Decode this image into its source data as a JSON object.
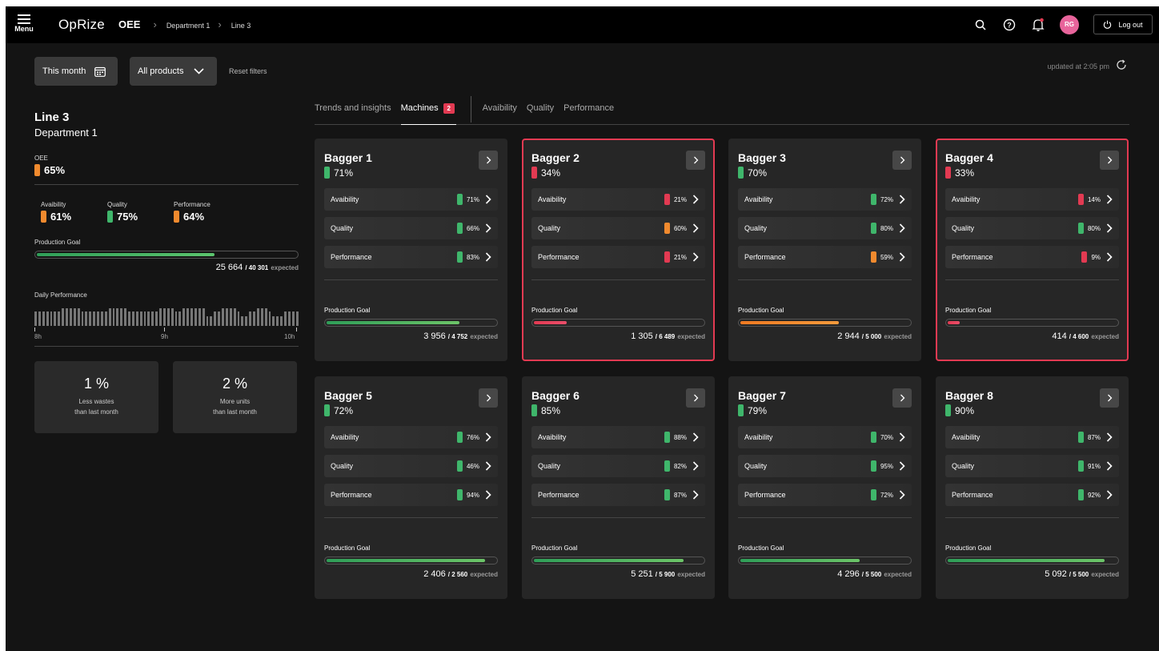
{
  "app": {
    "menu_label": "Menu",
    "logo": "OpRize"
  },
  "breadcrumb": {
    "root": "OEE",
    "dept": "Department 1",
    "line": "Line 3"
  },
  "user": {
    "initials": "RG",
    "logout_label": "Log out"
  },
  "filters": {
    "period": "This month",
    "products": "All products",
    "reset": "Reset filters",
    "updated": "updated at 2:05 pm"
  },
  "colors": {
    "green": "#3fb66b",
    "orange": "#f08a2e",
    "red": "#e23a52",
    "avatar": "#e8649b"
  },
  "line": {
    "title": "Line 3",
    "department": "Department 1",
    "oee_label": "OEE",
    "oee": "65%",
    "oee_color": "orange",
    "metrics": [
      {
        "label": "Avaibility",
        "value": "61%",
        "color": "orange"
      },
      {
        "label": "Quality",
        "value": "75%",
        "color": "green"
      },
      {
        "label": "Performance",
        "value": "64%",
        "color": "orange"
      }
    ],
    "goal_label": "Production Goal",
    "goal_fraction": 0.69,
    "goal_actual": "25 664",
    "goal_expected": "/ 40 301",
    "goal_suffix": "expected",
    "daily_label": "Daily Performance",
    "daily_levels": [
      0.75,
      0.75,
      0.75,
      0.75,
      0.75,
      0.75,
      0.75,
      0.9,
      0.9,
      0.9,
      0.9,
      0.9,
      0.75,
      0.75,
      0.75,
      0.75,
      0.75,
      0.75,
      0.75,
      0.9,
      0.9,
      0.9,
      0.9,
      0.9,
      0.75,
      0.75,
      0.75,
      0.75,
      0.75,
      0.75,
      0.75,
      0.75,
      0.9,
      0.9,
      0.9,
      0.9,
      0.75,
      0.75,
      0.9,
      0.9,
      0.9,
      0.9,
      0.9,
      0.9,
      0.5,
      0.5,
      0.75,
      0.75,
      0.9,
      0.9,
      0.9,
      0.9,
      0.75,
      0.5,
      0.5,
      0.75,
      0.75,
      0.9,
      0.9,
      0.9,
      0.75,
      0.5,
      0.5,
      0.5,
      0.75,
      0.75,
      0.75,
      0.75
    ],
    "axis": [
      "8h",
      "9h",
      "10h"
    ],
    "stats": [
      {
        "value": "1 %",
        "line1": "Less wastes",
        "line2": "than last month"
      },
      {
        "value": "2 %",
        "line1": "More units",
        "line2": "than last month"
      }
    ]
  },
  "tabs": {
    "trends": "Trends and insights",
    "machines": "Machines",
    "machines_badge": "2",
    "availability": "Avaibility",
    "quality": "Quality",
    "performance": "Performance"
  },
  "machine_labels": {
    "availability": "Avaibility",
    "quality": "Quality",
    "performance": "Performance",
    "goal": "Production Goal",
    "expected": "expected"
  },
  "machines": [
    {
      "name": "Bagger 1",
      "oee": "71%",
      "oee_color": "green",
      "alert": false,
      "availability": "71%",
      "availability_color": "green",
      "quality": "66%",
      "quality_color": "green",
      "performance": "83%",
      "performance_color": "green",
      "goal_fraction": 0.79,
      "goal_color": "green",
      "actual": "3 956",
      "expected": "/ 4 752"
    },
    {
      "name": "Bagger 2",
      "oee": "34%",
      "oee_color": "red",
      "alert": true,
      "availability": "21%",
      "availability_color": "red",
      "quality": "60%",
      "quality_color": "orange",
      "performance": "21%",
      "performance_color": "red",
      "goal_fraction": 0.21,
      "goal_color": "red",
      "actual": "1 305",
      "expected": " / 6 489"
    },
    {
      "name": "Bagger 3",
      "oee": "70%",
      "oee_color": "green",
      "alert": false,
      "availability": "72%",
      "availability_color": "green",
      "quality": "80%",
      "quality_color": "green",
      "performance": "59%",
      "performance_color": "orange",
      "goal_fraction": 0.59,
      "goal_color": "orange",
      "actual": "2 944",
      "expected": "/ 5 000"
    },
    {
      "name": "Bagger 4",
      "oee": "33%",
      "oee_color": "red",
      "alert": true,
      "availability": "14%",
      "availability_color": "red",
      "quality": "80%",
      "quality_color": "green",
      "performance": "9%",
      "performance_color": "red",
      "goal_fraction": 0.09,
      "goal_color": "red",
      "actual": "414",
      "expected": "/ 4 600"
    },
    {
      "name": "Bagger 5",
      "oee": "72%",
      "oee_color": "green",
      "alert": false,
      "availability": "76%",
      "availability_color": "green",
      "quality": "46%",
      "quality_color": "green",
      "performance": "94%",
      "performance_color": "green",
      "goal_fraction": 0.94,
      "goal_color": "green",
      "actual": "2 406",
      "expected": "/ 2 560"
    },
    {
      "name": "Bagger 6",
      "oee": "85%",
      "oee_color": "green",
      "alert": false,
      "availability": "88%",
      "availability_color": "green",
      "quality": "82%",
      "quality_color": "green",
      "performance": "87%",
      "performance_color": "green",
      "goal_fraction": 0.89,
      "goal_color": "green",
      "actual": "5 251",
      "expected": "/ 5 900"
    },
    {
      "name": "Bagger 7",
      "oee": "79%",
      "oee_color": "green",
      "alert": false,
      "availability": "70%",
      "availability_color": "green",
      "quality": "95%",
      "quality_color": "green",
      "performance": "72%",
      "performance_color": "green",
      "goal_fraction": 0.71,
      "goal_color": "green",
      "actual": "4 296",
      "expected": "/ 5 500"
    },
    {
      "name": "Bagger 8",
      "oee": "90%",
      "oee_color": "green",
      "alert": false,
      "availability": "87%",
      "availability_color": "green",
      "quality": "91%",
      "quality_color": "green",
      "performance": "92%",
      "performance_color": "green",
      "goal_fraction": 0.93,
      "goal_color": "green",
      "actual": "5 092",
      "expected": "/ 5 500"
    }
  ]
}
